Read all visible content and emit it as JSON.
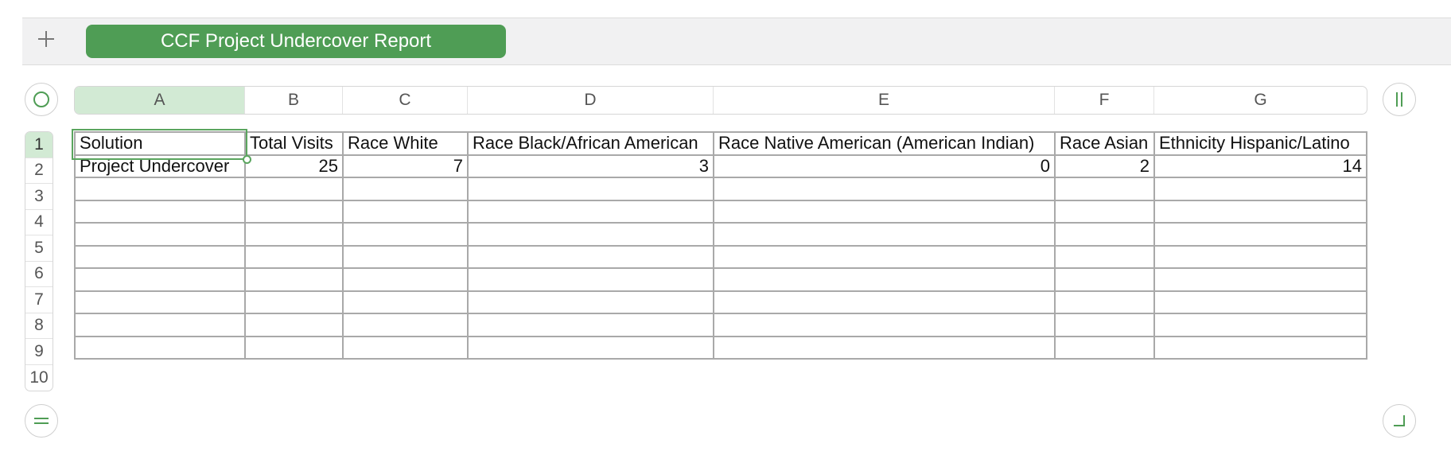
{
  "sheet": {
    "add_label": "+",
    "tab_name": "CCF Project Undercover Report"
  },
  "icons": {
    "add": "plus-icon",
    "select_all": "circle-icon",
    "add_rows": "double-bar-horizontal-icon",
    "add_cols": "double-bar-vertical-icon",
    "resize": "corner-icon"
  },
  "colors": {
    "accent": "#4f9d55",
    "selected_header": "#d2ead4"
  },
  "columns": [
    "A",
    "B",
    "C",
    "D",
    "E",
    "F",
    "G"
  ],
  "rows": [
    "1",
    "2",
    "3",
    "4",
    "5",
    "6",
    "7",
    "8",
    "9",
    "10"
  ],
  "table": {
    "header": [
      "Solution",
      "Total Visits",
      "Race White",
      "Race Black/African American",
      "Race Native American (American Indian)",
      "Race Asian",
      "Ethnicity Hispanic/Latino"
    ],
    "row2": [
      "Project Undercover",
      "25",
      "7",
      "3",
      "0",
      "2",
      "14"
    ]
  },
  "selection": {
    "cell": "A1"
  }
}
